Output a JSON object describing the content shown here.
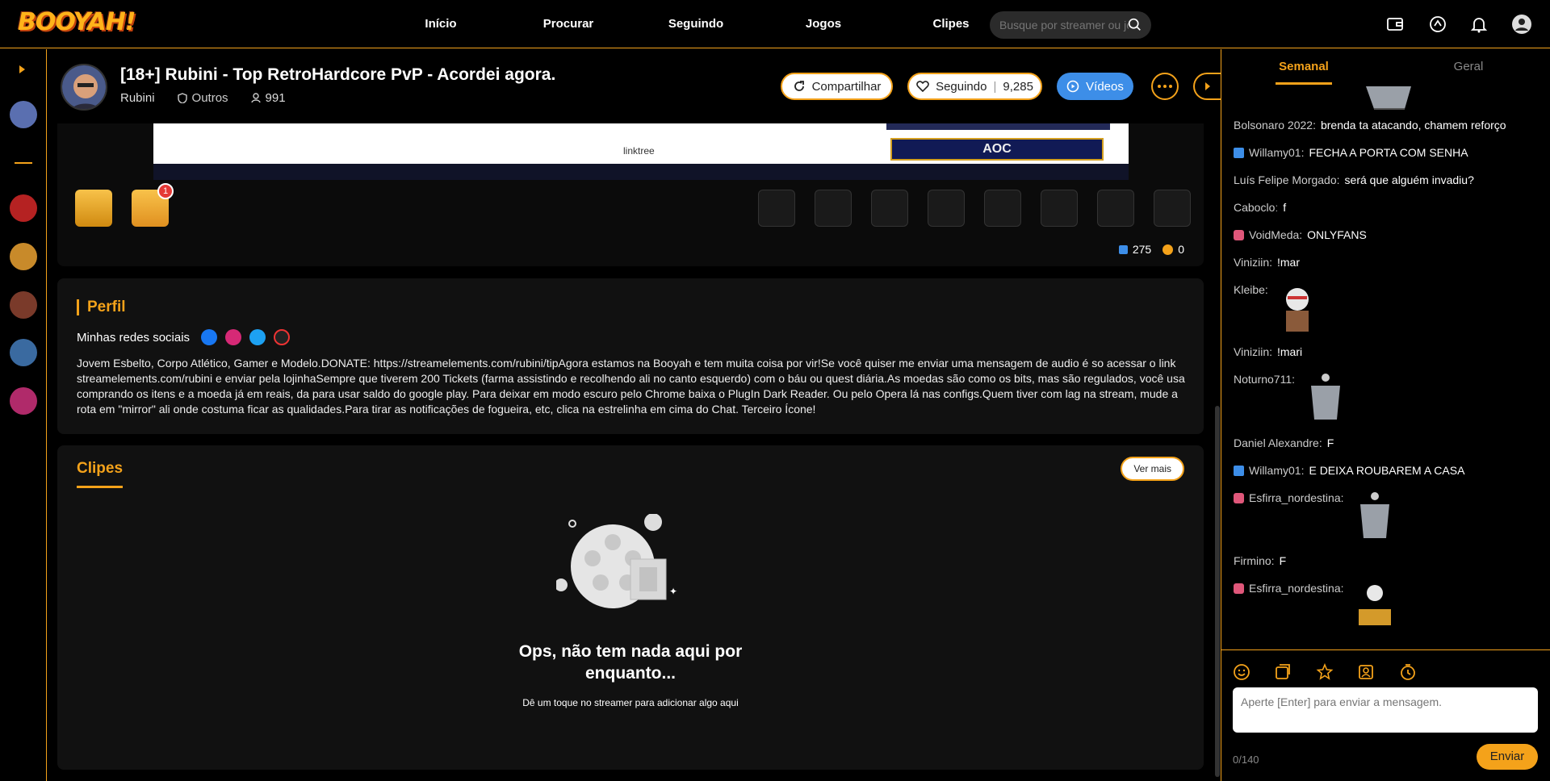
{
  "brand": {
    "logo_text": "BOOYAH!"
  },
  "nav": {
    "items": [
      "Início",
      "Procurar",
      "Seguindo",
      "Jogos",
      "Clipes"
    ]
  },
  "search": {
    "placeholder": "Busque por streamer ou jogo"
  },
  "stream": {
    "title": "[18+] Rubini - Top RetroHardcore PvP - Acordei agora.",
    "streamer": "Rubini",
    "category": "Outros",
    "viewers": "991",
    "share_label": "Compartilhar",
    "follow_label": "Seguindo",
    "followers": "9,285",
    "videos_label": "Vídeos"
  },
  "player": {
    "linktree": "linktree",
    "aoc": "AOC",
    "gift_badge": "1",
    "gems": "275",
    "coins": "0"
  },
  "profile": {
    "title": "Perfil",
    "socials_label": "Minhas redes sociais",
    "bio": "Jovem Esbelto, Corpo Atlético, Gamer e Modelo.DONATE:   https://streamelements.com/rubini/tipAgora estamos na Booyah e tem muita coisa por vir!Se você quiser me enviar uma mensagem de audio é so acessar o link streamelements.com/rubini e enviar pela lojinhaSempre que tiverem 200 Tickets (farma assistindo e recolhendo ali no canto esquerdo) com o báu ou quest diária.As moedas são como os bits, mas são regulados, você usa comprando os itens e a moeda já em reais, da para usar saldo do google play. Para deixar em modo escuro pelo Chrome baixa o PlugIn Dark Reader. Ou pelo Opera lá nas configs.Quem tiver com lag na stream, mude a rota em \"mirror\" ali onde costuma ficar as qualidades.Para tirar as notificações de fogueira, etc, clica na estrelinha em cima do Chat. Terceiro Ícone!"
  },
  "clips": {
    "title": "Clipes",
    "see_more": "Ver mais",
    "empty_title": "Ops, não tem nada aqui por enquanto...",
    "empty_sub": "Dê um toque no streamer para adicionar algo aqui"
  },
  "chat": {
    "tabs": [
      "Semanal",
      "Geral"
    ],
    "messages": [
      {
        "user": "Bolsonaro 2022:",
        "text": "brenda ta atacando, chamem reforço",
        "badge": ""
      },
      {
        "user": "Willamy01:",
        "text": "FECHA A PORTA COM SENHA",
        "badge": "shield"
      },
      {
        "user": "Luís Felipe Morgado:",
        "text": "será que alguém invadiu?",
        "badge": ""
      },
      {
        "user": "Cabocloː",
        "text": "f",
        "badge": ""
      },
      {
        "user": "VoidMeda:",
        "text": "ONLYFANS",
        "badge": "gift"
      },
      {
        "user": "Viniziin:",
        "text": "!mar",
        "badge": ""
      },
      {
        "user": "Kleibe:",
        "text": "",
        "badge": "",
        "sticker": "kratos"
      },
      {
        "user": "Viniziin:",
        "text": "!mari",
        "badge": ""
      },
      {
        "user": "Noturno711:",
        "text": "",
        "badge": "",
        "sticker": "coffin"
      },
      {
        "user": "Daniel Alexandre:",
        "text": "F",
        "badge": ""
      },
      {
        "user": "Willamy01:",
        "text": "E DEIXA ROUBAREM A CASA",
        "badge": "shield"
      },
      {
        "user": "Esfirra_nordestina:",
        "text": "",
        "badge": "gift",
        "sticker": "coffin"
      },
      {
        "user": "Firmino:",
        "text": "F",
        "badge": ""
      },
      {
        "user": "Esfirra_nordestina:",
        "text": "",
        "badge": "gift",
        "sticker": "skeleton"
      }
    ],
    "input_placeholder": "Aperte [Enter] para enviar a mensagem.",
    "char_count": "0/140",
    "send_label": "Enviar"
  },
  "colors": {
    "accent": "#f4a21a",
    "blue": "#3d8ee8",
    "card": "#111111"
  }
}
